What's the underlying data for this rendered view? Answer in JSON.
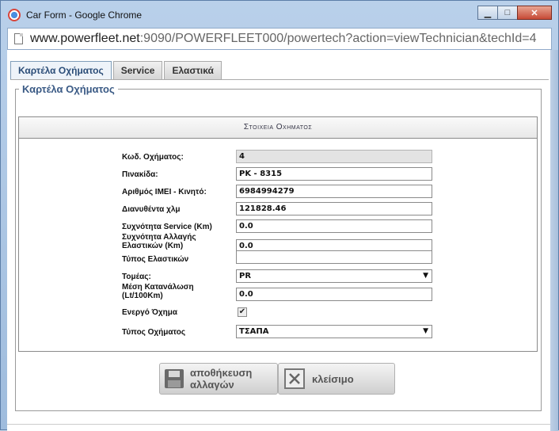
{
  "window": {
    "title": "Car Form - Google Chrome",
    "minimize": "▁",
    "maximize": "□",
    "close": "✕"
  },
  "address": {
    "host": "www.powerfleet.net",
    "rest": ":9090/POWERFLEET000/powertech?action=viewTechnician&techId=4"
  },
  "tabs": [
    "Καρτέλα Οχήματος",
    "Service",
    "Ελαστικά"
  ],
  "fieldset_legend": "Καρτέλα Οχήματος",
  "section_title": "Στοιχεια Οχηματος",
  "fields": [
    {
      "label": "Κωδ. Οχήματος:",
      "value": "4"
    },
    {
      "label": "Πινακίδα:",
      "value": "PK - 8315"
    },
    {
      "label": "Αριθμός IMEI - Κινητό:",
      "value": "6984994279"
    },
    {
      "label": "Διανυθέντα χλμ",
      "value": "121828.46"
    },
    {
      "label": "Συχνότητα Service (Km)",
      "value": "0.0"
    },
    {
      "label": "Συχνότητα Αλλαγής Ελαστικών (Km)",
      "value": "0.0"
    },
    {
      "label": "Τύπος Ελαστικών",
      "value": ""
    },
    {
      "label": "Τομέας:",
      "value": "PR"
    },
    {
      "label": "Μέση Κατανάλωση (Lt/100Km)",
      "value": "0.0"
    },
    {
      "label": "Ενεργό Όχημα",
      "value": "✔"
    },
    {
      "label": "Τύπος Οχήματος",
      "value": "ΤΣΑΠΑ"
    }
  ],
  "buttons": {
    "save": "αποθήκευση αλλαγών",
    "close": "κλείσιμο"
  },
  "icons": {
    "save": "floppy-disk-icon",
    "close": "close-box-icon",
    "dropdown": "▼"
  }
}
